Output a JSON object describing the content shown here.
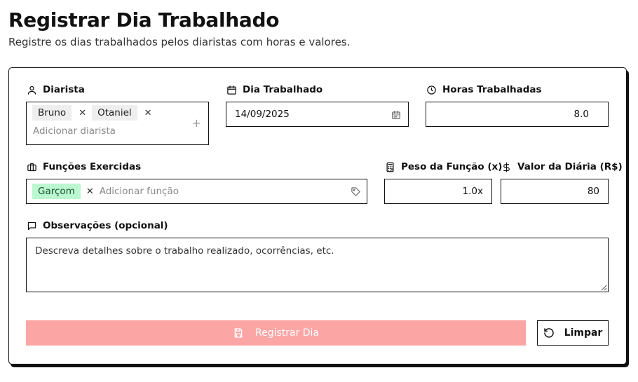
{
  "header": {
    "title": "Registrar Dia Trabalhado",
    "subtitle": "Registre os dias trabalhados pelos diaristas com horas e valores."
  },
  "form": {
    "diarista": {
      "label": "Diarista",
      "icon": "user-icon",
      "chips": [
        "Bruno",
        "Otaniel"
      ],
      "placeholder": "Adicionar diarista"
    },
    "dia": {
      "label": "Dia Trabalhado",
      "icon": "calendar-icon",
      "value": "14/09/2025"
    },
    "horas": {
      "label": "Horas Trabalhadas",
      "icon": "clock-icon",
      "value": "8.0"
    },
    "funcoes": {
      "label": "Funções Exercidas",
      "icon": "briefcase-icon",
      "chips": [
        "Garçom"
      ],
      "placeholder": "Adicionar função",
      "chip_color": "#bbf7d0"
    },
    "peso": {
      "label": "Peso da Função (x)",
      "icon": "calculator-icon",
      "value": "1.0x"
    },
    "valor": {
      "label": "Valor da Diária (R$)",
      "icon": "dollar-icon",
      "value": "80"
    },
    "observacoes": {
      "label": "Observações (opcional)",
      "icon": "message-icon",
      "placeholder": "Descreva detalhes sobre o trabalho realizado, ocorrências, etc."
    }
  },
  "actions": {
    "submit_label": "Registrar Dia",
    "submit_color": "#fca5a5",
    "clear_label": "Limpar"
  }
}
